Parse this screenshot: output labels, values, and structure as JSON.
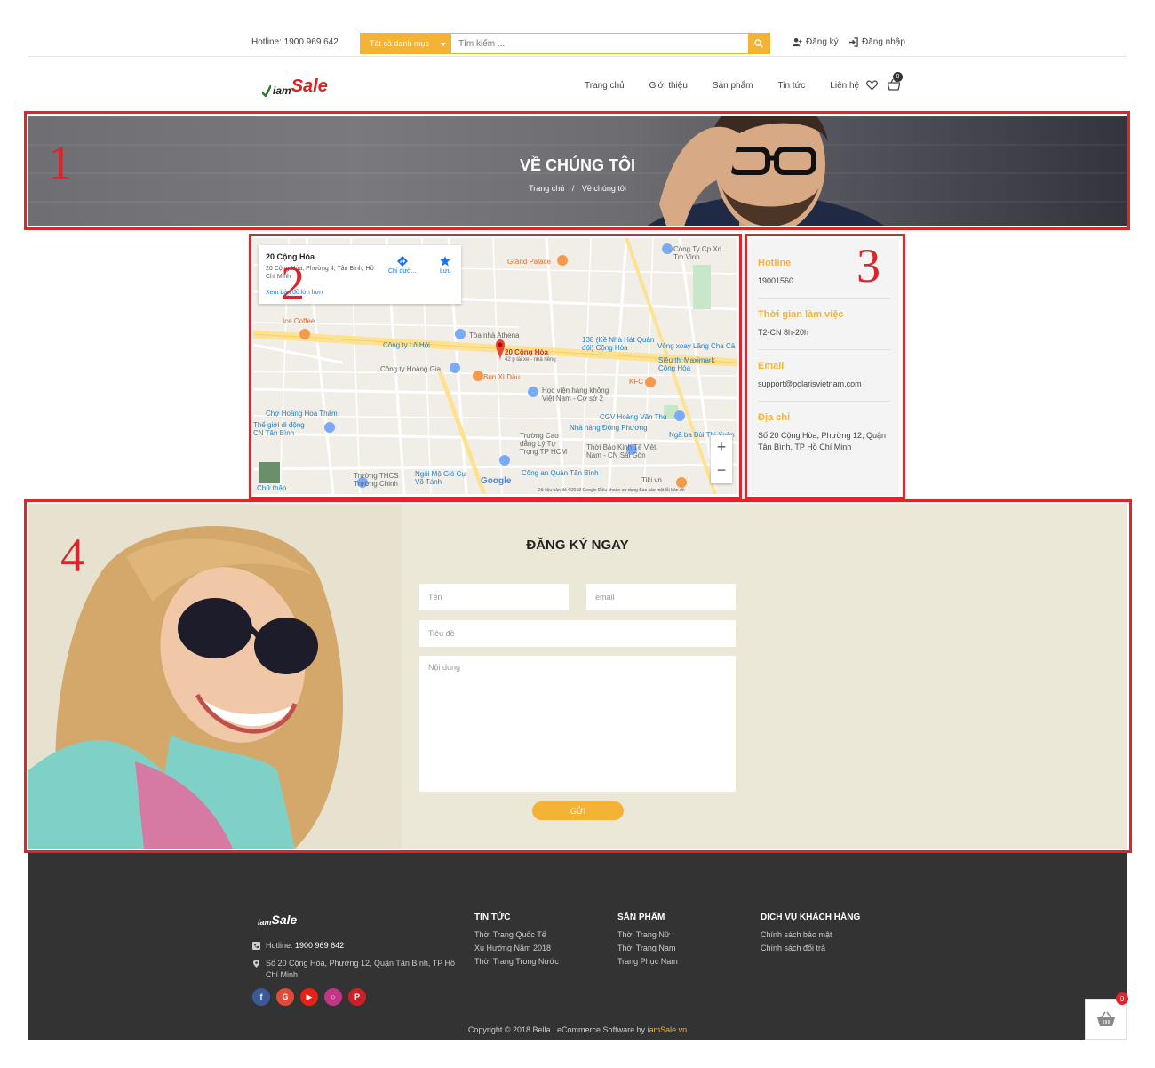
{
  "topbar": {
    "hotline": "Hotline: 1900 969 642",
    "category_label": "Tất cả danh mục",
    "search_placeholder": "Tìm kiếm ...",
    "register": "Đăng ký",
    "login": "Đăng nhập"
  },
  "header": {
    "logo_small": "iam",
    "logo_big": "Sale",
    "nav": [
      "Trang chủ",
      "Giới thiệu",
      "Sản phẩm",
      "Tin tức",
      "Liên hệ"
    ],
    "cart_count": "0"
  },
  "banner": {
    "title": "VỀ CHÚNG TÔI",
    "breadcrumb_home": "Trang chủ",
    "breadcrumb_sep": "/",
    "breadcrumb_current": "Về chúng tôi"
  },
  "annotations": [
    "1",
    "2",
    "3",
    "4"
  ],
  "map": {
    "place_title": "20 Cộng Hòa",
    "place_address": "20 Cộng Hòa, Phường 4, Tân Bình, Hồ Chí Minh",
    "view_larger": "Xem bản đồ lớn hơn",
    "directions": "Chỉ đườ...",
    "save": "Lưu",
    "pin_label": "20 Cộng Hòa",
    "pin_sub": "42 p lái xe - nhà riêng",
    "zoom_in": "+",
    "zoom_out": "−",
    "google": "Google",
    "footer_text": "Dữ liệu bản đồ ©2018 Google   Điều khoản sử dụng   Báo cáo một lỗi bản đồ",
    "labels": {
      "grand_palace": "Grand Palace",
      "ice_coffee": "Ice Coffee",
      "athena": "Tòa nhà Athena",
      "lo_hoi": "Công ty Lô Hội",
      "hoang_gia": "Công ty Hoàng Gia",
      "bun": "Bún Xì Dầu",
      "kfc": "KFC",
      "hvhk": "Học viện hàng không Việt Nam - Cơ sở 2",
      "cho": "Chợ Hoàng Hoa Thám",
      "tgdd": "Thế giới di động CN Tân Bình",
      "cgv": "CGV Hoàng Văn Thụ",
      "ndp": "Nhà hàng Đông Phương",
      "maximark": "Siêu thị Maximark Cộng Hòa",
      "cong_hoa_138": "138 (Kề Nhà Hát Quân đội) Cộng Hòa",
      "vong_xoay": "Vòng xoay Lăng Cha Cả",
      "tbk": "Thời Báo Kinh Tế Việt Nam - CN Sài Gòn",
      "ly_tu_trong": "Trường Cao đẳng Lý Tự Trọng TP HCM",
      "thcs": "Trường THCS Trường Chinh",
      "ngoi_mo_gio": "Ngôi Mộ Gió Cụ Võ Tánh",
      "cong_an": "Công an Quận Tân Bình",
      "tiki": "Tiki.vn",
      "nga_ba": "Ngã ba Bùi Thị Xuân",
      "cong_ty_cp": "Công Ty Cp Xd Tm Vinh",
      "cho_thap": "Chữ thập"
    }
  },
  "contact": [
    {
      "label": "Hotline",
      "value": "19001560"
    },
    {
      "label": "Thời gian làm việc",
      "value": "T2-CN 8h-20h"
    },
    {
      "label": "Email",
      "value": "support@polarisvietnam.com"
    },
    {
      "label": "Địa chỉ",
      "value": "Số 20 Cộng Hòa, Phường 12, Quận Tân Bình, TP Hồ Chí Minh"
    }
  ],
  "register": {
    "title": "ĐĂNG KÝ NGAY",
    "name_placeholder": "Tên",
    "email_placeholder": "email",
    "subject_placeholder": "Tiêu đề",
    "content_placeholder": "Nội dung",
    "submit": "GỬI"
  },
  "footer": {
    "logo_small": "iam",
    "logo_big": "Sale",
    "hotline_label": "Hotline:",
    "hotline_value": "1900 969 642",
    "address": "Số 20 Cộng Hòa, Phường 12, Quận Tân Bình, TP Hồ Chí Minh",
    "columns": [
      {
        "title": "TIN TỨC",
        "links": [
          "Thời Trang Quốc Tế",
          "Xu Hướng Năm 2018",
          "Thời Trang Trong Nước"
        ]
      },
      {
        "title": "SẢN PHẨM",
        "links": [
          "Thời Trang Nữ",
          "Thời Trang Nam",
          "Trang Phục Nam"
        ]
      },
      {
        "title": "DỊCH VỤ KHÁCH HÀNG",
        "links": [
          "Chính sách bảo mật",
          "Chính sách đổi trả"
        ]
      }
    ],
    "social_colors": [
      "#3b5998",
      "#dd4b39",
      "#e62117",
      "#c13584",
      "#cb2027"
    ],
    "copyright": "Copyright © 2018 Bella . eCommerce Software by",
    "copyright_brand": "iamSale.vn"
  },
  "floating_cart_count": "0",
  "colors": {
    "accent": "#f5b335",
    "annotation": "#e1232b",
    "footer_bg": "#333333"
  }
}
